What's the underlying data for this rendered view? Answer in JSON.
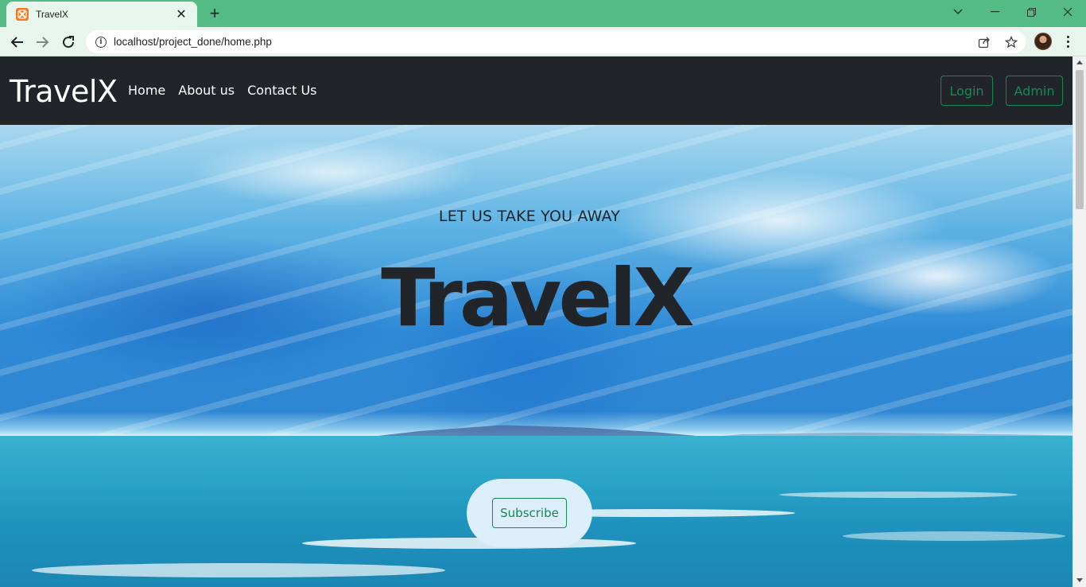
{
  "browser": {
    "tab_title": "TravelX",
    "url": "localhost/project_done/home.php"
  },
  "navbar": {
    "brand": "TravelX",
    "links": [
      "Home",
      "About us",
      "Contact Us"
    ],
    "login_label": "Login",
    "admin_label": "Admin"
  },
  "hero": {
    "kicker": "LET US TAKE YOU AWAY",
    "title": "TravelX",
    "subscribe_label": "Subscribe"
  },
  "colors": {
    "tabstrip": "#54bb85",
    "navbar_bg": "#212529",
    "accent_green": "#198754",
    "subscribe_pill": "#dceefa"
  }
}
